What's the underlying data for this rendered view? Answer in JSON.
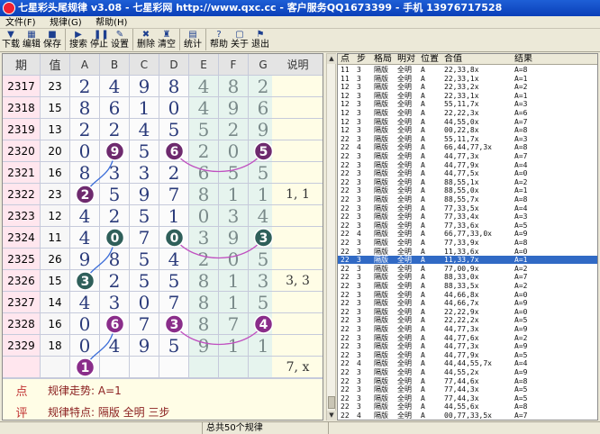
{
  "window": {
    "title": "七星彩头尾规律  v3.08 - 七星彩网 http://www.qxc.cc - 客户服务QQ1673399 - 手机 13976717528"
  },
  "menu": [
    "文件(F)",
    "规律(G)",
    "帮助(H)"
  ],
  "toolbar": [
    {
      "label": "下载",
      "icon": "download-icon",
      "glyph": "▼"
    },
    {
      "label": "编辑",
      "icon": "edit-icon",
      "glyph": "▦"
    },
    {
      "label": "保存",
      "icon": "save-icon",
      "glyph": "■"
    },
    {
      "label": "搜索",
      "icon": "play-icon",
      "glyph": "▶"
    },
    {
      "label": "停止",
      "icon": "pause-icon",
      "glyph": "❚❚"
    },
    {
      "label": "设置",
      "icon": "settings-icon",
      "glyph": "✎"
    },
    {
      "label": "删除",
      "icon": "delete-icon",
      "glyph": "✖"
    },
    {
      "label": "清空",
      "icon": "clear-icon",
      "glyph": "♜"
    },
    {
      "label": "统计",
      "icon": "stats-icon",
      "glyph": "▤"
    },
    {
      "label": "帮助",
      "icon": "help-icon",
      "glyph": "?"
    },
    {
      "label": "关于",
      "icon": "about-icon",
      "glyph": "▢"
    },
    {
      "label": "退出",
      "icon": "exit-icon",
      "glyph": "⚑"
    }
  ],
  "grid": {
    "headers": [
      "期",
      "值",
      "A",
      "B",
      "C",
      "D",
      "E",
      "F",
      "G",
      "说明"
    ],
    "rows": [
      {
        "period": "2317",
        "value": "23",
        "digits": [
          "2",
          "4",
          "9",
          "8",
          "4",
          "8",
          "2"
        ],
        "note": ""
      },
      {
        "period": "2318",
        "value": "15",
        "digits": [
          "8",
          "6",
          "1",
          "0",
          "4",
          "9",
          "6"
        ],
        "note": ""
      },
      {
        "period": "2319",
        "value": "13",
        "digits": [
          "2",
          "2",
          "4",
          "5",
          "5",
          "2",
          "9"
        ],
        "note": ""
      },
      {
        "period": "2320",
        "value": "20",
        "digits": [
          "0",
          "9",
          "5",
          "6",
          "2",
          "0",
          "5"
        ],
        "note": ""
      },
      {
        "period": "2321",
        "value": "16",
        "digits": [
          "8",
          "3",
          "3",
          "2",
          "6",
          "5",
          "5"
        ],
        "note": ""
      },
      {
        "period": "2322",
        "value": "23",
        "digits": [
          "2",
          "5",
          "9",
          "7",
          "8",
          "1",
          "1"
        ],
        "note": "1, 1"
      },
      {
        "period": "2323",
        "value": "12",
        "digits": [
          "4",
          "2",
          "5",
          "1",
          "0",
          "3",
          "4"
        ],
        "note": ""
      },
      {
        "period": "2324",
        "value": "11",
        "digits": [
          "4",
          "0",
          "7",
          "0",
          "3",
          "9",
          "3"
        ],
        "note": ""
      },
      {
        "period": "2325",
        "value": "26",
        "digits": [
          "9",
          "8",
          "5",
          "4",
          "2",
          "0",
          "5"
        ],
        "note": ""
      },
      {
        "period": "2326",
        "value": "15",
        "digits": [
          "3",
          "2",
          "5",
          "5",
          "8",
          "1",
          "3"
        ],
        "note": "3, 3"
      },
      {
        "period": "2327",
        "value": "14",
        "digits": [
          "4",
          "3",
          "0",
          "7",
          "8",
          "1",
          "5"
        ],
        "note": ""
      },
      {
        "period": "2328",
        "value": "16",
        "digits": [
          "0",
          "6",
          "7",
          "3",
          "8",
          "7",
          "4"
        ],
        "note": ""
      },
      {
        "period": "2329",
        "value": "18",
        "digits": [
          "0",
          "4",
          "9",
          "5",
          "9",
          "1",
          "1"
        ],
        "note": ""
      },
      {
        "period": "",
        "value": "",
        "digits": [
          "1",
          "",
          "",
          "",
          "",
          "",
          ""
        ],
        "note": "7, x"
      }
    ],
    "footer": {
      "label1": "点",
      "text1": "规律走势: A=1",
      "label2": "评",
      "text2": "规律特点: 隔版 全明 三步"
    }
  },
  "circles": [
    {
      "row": 3,
      "col": 1,
      "num": "9",
      "color": "#6e2a6e"
    },
    {
      "row": 3,
      "col": 3,
      "num": "6",
      "color": "#6e2a6e"
    },
    {
      "row": 3,
      "col": 6,
      "num": "5",
      "color": "#6e2a6e"
    },
    {
      "row": 5,
      "col": 0,
      "num": "2",
      "color": "#6e2a6e"
    },
    {
      "row": 7,
      "col": 1,
      "num": "0",
      "color": "#2f5f5a"
    },
    {
      "row": 7,
      "col": 3,
      "num": "0",
      "color": "#2f5f5a"
    },
    {
      "row": 7,
      "col": 6,
      "num": "3",
      "color": "#2f5f5a"
    },
    {
      "row": 9,
      "col": 0,
      "num": "3",
      "color": "#2f5f5a"
    },
    {
      "row": 11,
      "col": 1,
      "num": "6",
      "color": "#8a2d8a"
    },
    {
      "row": 11,
      "col": 3,
      "num": "3",
      "color": "#8a2d8a"
    },
    {
      "row": 11,
      "col": 6,
      "num": "4",
      "color": "#8a2d8a"
    },
    {
      "row": 13,
      "col": 0,
      "num": "1",
      "color": "#8a2d8a"
    }
  ],
  "list": {
    "headers": [
      "点",
      "步",
      "格局",
      "明对",
      "位置",
      "合值",
      "结果"
    ],
    "rows": [
      [
        "11",
        "3",
        "隔版",
        "全明",
        "A",
        "22,33,8x",
        "A=8"
      ],
      [
        "11",
        "3",
        "隔版",
        "全明",
        "A",
        "22,33,1x",
        "A=1"
      ],
      [
        "12",
        "3",
        "隔版",
        "全明",
        "A",
        "22,33,2x",
        "A=2"
      ],
      [
        "12",
        "3",
        "隔版",
        "全明",
        "A",
        "22,33,1x",
        "A=1"
      ],
      [
        "12",
        "3",
        "隔版",
        "全明",
        "A",
        "55,11,7x",
        "A=3"
      ],
      [
        "12",
        "3",
        "隔版",
        "全明",
        "A",
        "22,22,3x",
        "A=6"
      ],
      [
        "12",
        "3",
        "隔版",
        "全明",
        "A",
        "44,55,0x",
        "A=7"
      ],
      [
        "12",
        "3",
        "隔版",
        "全明",
        "A",
        "00,22,8x",
        "A=8"
      ],
      [
        "22",
        "3",
        "隔版",
        "全明",
        "A",
        "55,11,7x",
        "A=3"
      ],
      [
        "22",
        "4",
        "隔版",
        "全明",
        "A",
        "66,44,77,3x",
        "A=8"
      ],
      [
        "22",
        "3",
        "隔版",
        "全明",
        "A",
        "44,77,3x",
        "A=7"
      ],
      [
        "22",
        "3",
        "隔版",
        "全明",
        "A",
        "44,77,9x",
        "A=4"
      ],
      [
        "22",
        "3",
        "隔版",
        "全明",
        "A",
        "44,77,5x",
        "A=0"
      ],
      [
        "22",
        "3",
        "隔版",
        "全明",
        "A",
        "88,55,1x",
        "A=2"
      ],
      [
        "22",
        "3",
        "隔版",
        "全明",
        "A",
        "88,55,0x",
        "A=1"
      ],
      [
        "22",
        "3",
        "隔版",
        "全明",
        "A",
        "88,55,7x",
        "A=8"
      ],
      [
        "22",
        "3",
        "隔版",
        "全明",
        "A",
        "77,33,5x",
        "A=4"
      ],
      [
        "22",
        "3",
        "隔版",
        "全明",
        "A",
        "77,33,4x",
        "A=3"
      ],
      [
        "22",
        "3",
        "隔版",
        "全明",
        "A",
        "77,33,6x",
        "A=5"
      ],
      [
        "22",
        "4",
        "隔版",
        "全明",
        "A",
        "66,77,33,0x",
        "A=9"
      ],
      [
        "22",
        "3",
        "隔版",
        "全明",
        "A",
        "77,33,9x",
        "A=8"
      ],
      [
        "22",
        "3",
        "隔版",
        "全明",
        "A",
        "11,33,6x",
        "A=0"
      ],
      [
        "22",
        "3",
        "隔版",
        "全明",
        "A",
        "11,33,7x",
        "A=1"
      ],
      [
        "22",
        "3",
        "隔版",
        "全明",
        "A",
        "77,00,9x",
        "A=2"
      ],
      [
        "22",
        "3",
        "隔版",
        "全明",
        "A",
        "88,33,0x",
        "A=7"
      ],
      [
        "22",
        "3",
        "隔版",
        "全明",
        "A",
        "88,33,5x",
        "A=2"
      ],
      [
        "22",
        "3",
        "隔版",
        "全明",
        "A",
        "44,66,8x",
        "A=0"
      ],
      [
        "22",
        "3",
        "隔版",
        "全明",
        "A",
        "44,66,7x",
        "A=9"
      ],
      [
        "22",
        "3",
        "隔版",
        "全明",
        "A",
        "22,22,9x",
        "A=0"
      ],
      [
        "22",
        "3",
        "隔版",
        "全明",
        "A",
        "22,22,2x",
        "A=5"
      ],
      [
        "22",
        "3",
        "隔版",
        "全明",
        "A",
        "44,77,3x",
        "A=9"
      ],
      [
        "22",
        "3",
        "隔版",
        "全明",
        "A",
        "44,77,6x",
        "A=2"
      ],
      [
        "22",
        "3",
        "隔版",
        "全明",
        "A",
        "44,77,3x",
        "A=9"
      ],
      [
        "22",
        "3",
        "隔版",
        "全明",
        "A",
        "44,77,9x",
        "A=5"
      ],
      [
        "22",
        "4",
        "隔版",
        "全明",
        "A",
        "44,44,55,7x",
        "A=4"
      ],
      [
        "22",
        "3",
        "隔版",
        "全明",
        "A",
        "44,55,2x",
        "A=9"
      ],
      [
        "22",
        "3",
        "隔版",
        "全明",
        "A",
        "77,44,6x",
        "A=8"
      ],
      [
        "22",
        "3",
        "隔版",
        "全明",
        "A",
        "77,44,3x",
        "A=5"
      ],
      [
        "22",
        "3",
        "隔版",
        "全明",
        "A",
        "77,44,3x",
        "A=5"
      ],
      [
        "22",
        "3",
        "隔版",
        "全明",
        "A",
        "44,55,6x",
        "A=8"
      ],
      [
        "22",
        "4",
        "隔版",
        "全明",
        "A",
        "00,77,33,5x",
        "A=7"
      ]
    ],
    "selected_index": 22
  },
  "status": {
    "text": "总共50个规律"
  }
}
